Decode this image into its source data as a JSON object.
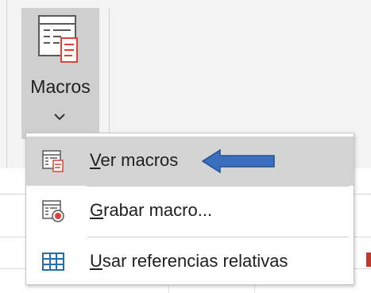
{
  "ribbon": {
    "macros_button": {
      "label": "Macros",
      "icon": "macros-icon",
      "dropdown_icon": "chevron-down-icon"
    }
  },
  "menu": {
    "items": [
      {
        "accel": "V",
        "rest": "er macros",
        "icon": "view-macros-icon",
        "highlighted": true
      },
      {
        "accel": "G",
        "rest": "rabar macro...",
        "icon": "record-macro-icon",
        "highlighted": false
      },
      {
        "accel": "U",
        "rest": "sar referencias relativas",
        "icon": "relative-references-icon",
        "highlighted": false
      }
    ]
  },
  "annotation": {
    "arrow_icon": "arrow-left-icon",
    "arrow_color": "#3a6fbf"
  },
  "colors": {
    "accent_red": "#e0403a",
    "icon_blue": "#1f6fb5",
    "hover_gray": "#d4d4d4"
  }
}
